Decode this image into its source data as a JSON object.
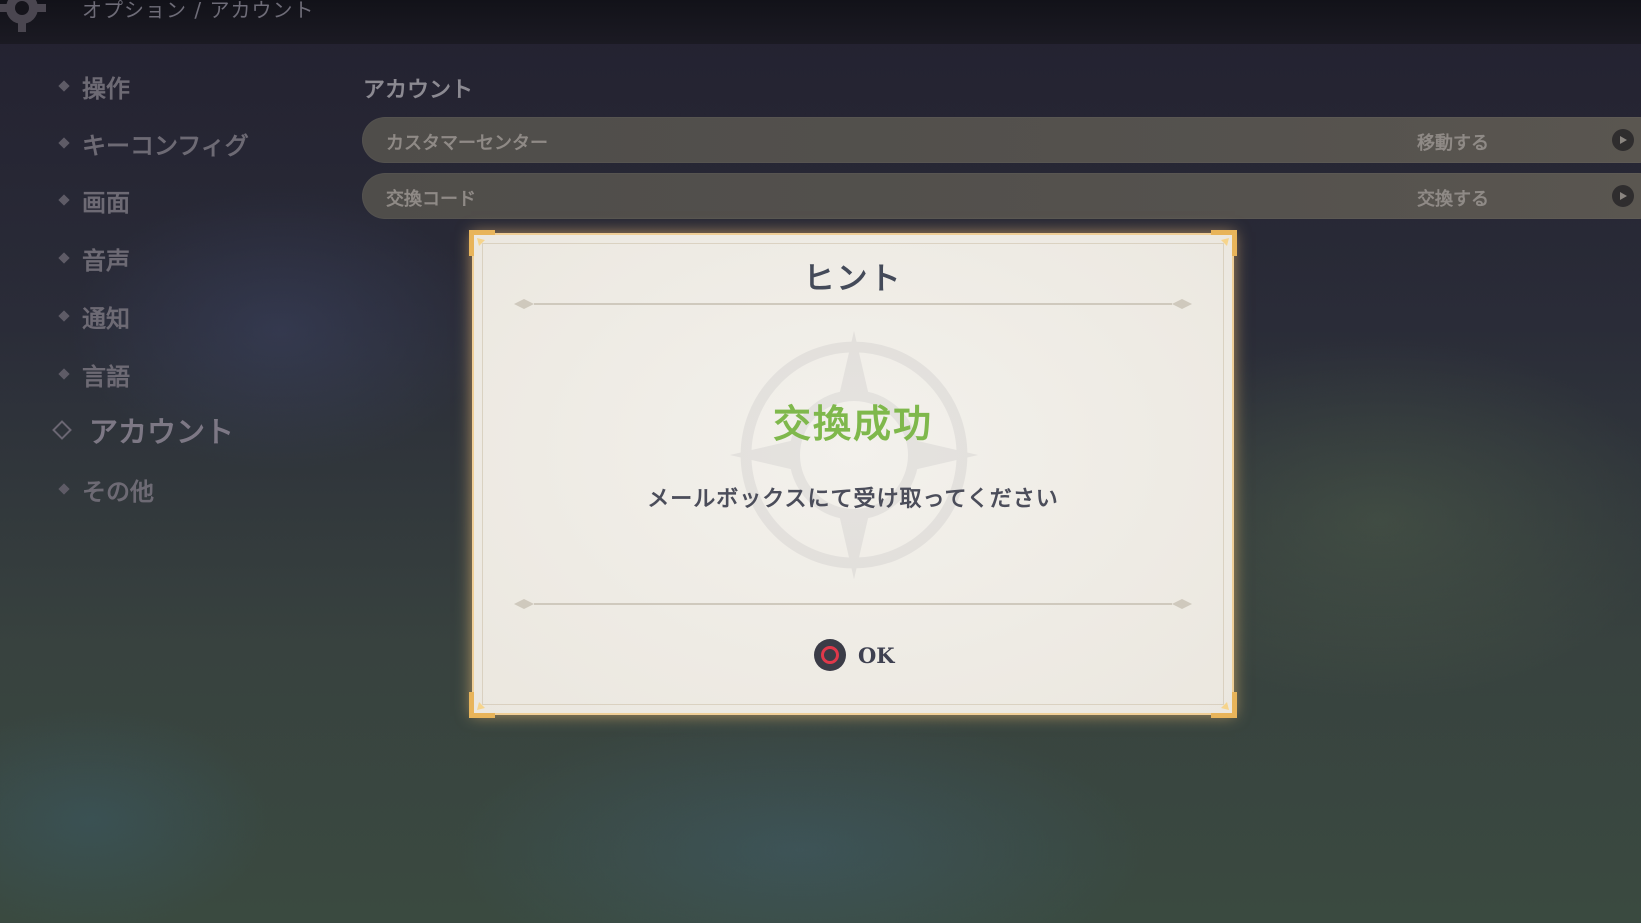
{
  "header": {
    "breadcrumb": "オプション / アカウント",
    "icon": "gear-icon"
  },
  "sidebar": {
    "items": [
      {
        "label": "操作"
      },
      {
        "label": "キーコンフィグ"
      },
      {
        "label": "画面"
      },
      {
        "label": "音声"
      },
      {
        "label": "通知"
      },
      {
        "label": "言語"
      },
      {
        "label": "アカウント",
        "active": true
      },
      {
        "label": "その他"
      }
    ]
  },
  "main": {
    "section_title": "アカウント",
    "rows": [
      {
        "label": "カスタマーセンター",
        "action": "移動する",
        "icon": "play-arrow-icon"
      },
      {
        "label": "交換コード",
        "action": "交換する",
        "icon": "play-arrow-icon"
      }
    ]
  },
  "dialog": {
    "title": "ヒント",
    "status": "交換成功",
    "message": "メールボックスにて受け取ってください",
    "confirm_label": "OK",
    "confirm_icon": "circle-button-icon",
    "colors": {
      "status": "#7fb84c",
      "confirm_icon_ring": "#e0384a"
    }
  }
}
